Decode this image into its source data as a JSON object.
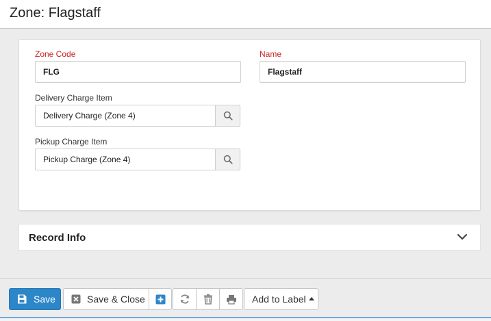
{
  "page": {
    "title": "Zone: Flagstaff"
  },
  "form": {
    "zone_code": {
      "label": "Zone Code",
      "value": "FLG"
    },
    "name": {
      "label": "Name",
      "value": "Flagstaff"
    },
    "delivery_charge_item": {
      "label": "Delivery Charge Item",
      "value": "Delivery Charge (Zone 4)"
    },
    "pickup_charge_item": {
      "label": "Pickup Charge Item",
      "value": "Pickup Charge (Zone 4)"
    }
  },
  "record_info": {
    "title": "Record Info"
  },
  "toolbar": {
    "save_label": "Save",
    "save_close_label": "Save & Close",
    "add_to_label_label": "Add to Label"
  },
  "colors": {
    "required": "#cc2222",
    "primary": "#2c86c8",
    "accent_line": "#6fa8dc"
  },
  "icons": [
    "search-icon",
    "chevron-down-icon",
    "save-icon",
    "close-icon",
    "plus-icon",
    "refresh-icon",
    "trash-icon",
    "print-icon",
    "caret-up-icon"
  ]
}
